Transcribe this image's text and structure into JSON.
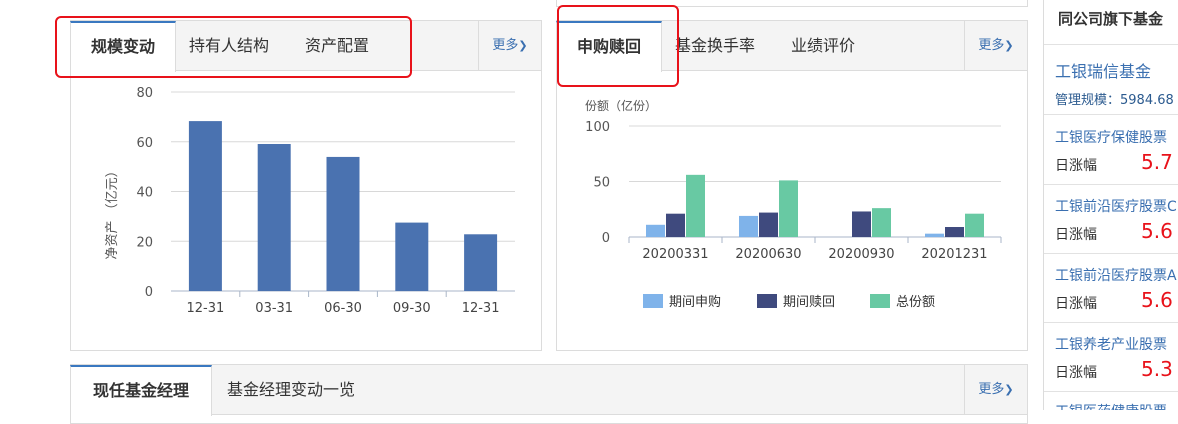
{
  "scale_panel": {
    "tabs": [
      "规模变动",
      "持有人结构",
      "资产配置"
    ],
    "more": "更多",
    "chart_data": {
      "type": "bar",
      "categories": [
        "12-31",
        "03-31",
        "06-30",
        "09-30",
        "12-31"
      ],
      "values": [
        68.3,
        59.1,
        53.9,
        27.5,
        22.8
      ],
      "ylabel": "净资产 （亿元）",
      "ylim": [
        0,
        80
      ],
      "yticks": [
        0,
        20,
        40,
        60,
        80
      ],
      "color": "#4a72b0",
      "grid": true
    }
  },
  "subscription_panel": {
    "tabs": [
      "申购赎回",
      "基金换手率",
      "业绩评价"
    ],
    "more": "更多",
    "chart_data": {
      "type": "bar",
      "ylabel": "份额（亿份）",
      "ylim": [
        0,
        100
      ],
      "yticks": [
        0,
        50,
        100
      ],
      "categories": [
        "20200331",
        "20200630",
        "20200930",
        "20201231"
      ],
      "series": [
        {
          "name": "期间申购",
          "color": "#7fb3ea",
          "values": [
            11,
            19,
            0,
            3
          ]
        },
        {
          "name": "期间赎回",
          "color": "#3f4a7e",
          "values": [
            21,
            22,
            23,
            9
          ]
        },
        {
          "name": "总份额",
          "color": "#68c9a3",
          "values": [
            56,
            51,
            26,
            21
          ]
        }
      ],
      "legend": "bottom",
      "grid": true
    }
  },
  "manager_panel": {
    "tabs": [
      "现任基金经理",
      "基金经理变动一览"
    ],
    "more": "更多"
  },
  "sidebar": {
    "title": "同公司旗下基金",
    "company": "工银瑞信基金",
    "scale_label": "管理规模：5984.68",
    "funds": [
      {
        "name": "工银医疗保健股票",
        "label": "日涨幅",
        "value": "5.7"
      },
      {
        "name": "工银前沿医疗股票C",
        "label": "日涨幅",
        "value": "5.6"
      },
      {
        "name": "工银前沿医疗股票A",
        "label": "日涨幅",
        "value": "5.6"
      },
      {
        "name": "工银养老产业股票",
        "label": "日涨幅",
        "value": "5.3"
      },
      {
        "name": "工银医药健康股票",
        "label": "",
        "value": ""
      }
    ]
  }
}
